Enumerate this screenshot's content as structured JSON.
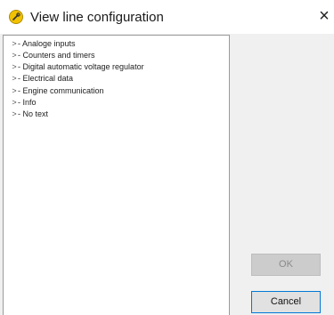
{
  "window": {
    "title": "View line configuration",
    "close_glyph": "×",
    "icon": "wrench-badge-icon",
    "icon_color": "#f2c200"
  },
  "tree": {
    "expander_glyph": ">",
    "items": [
      {
        "label": "- Analoge inputs"
      },
      {
        "label": "- Counters and timers"
      },
      {
        "label": "- Digital automatic voltage regulator"
      },
      {
        "label": "- Electrical data"
      },
      {
        "label": "- Engine communication"
      },
      {
        "label": "- Info"
      },
      {
        "label": "- No text"
      }
    ]
  },
  "buttons": {
    "ok_label": "OK",
    "cancel_label": "Cancel",
    "ok_enabled": false,
    "accent_color": "#0078d7"
  }
}
